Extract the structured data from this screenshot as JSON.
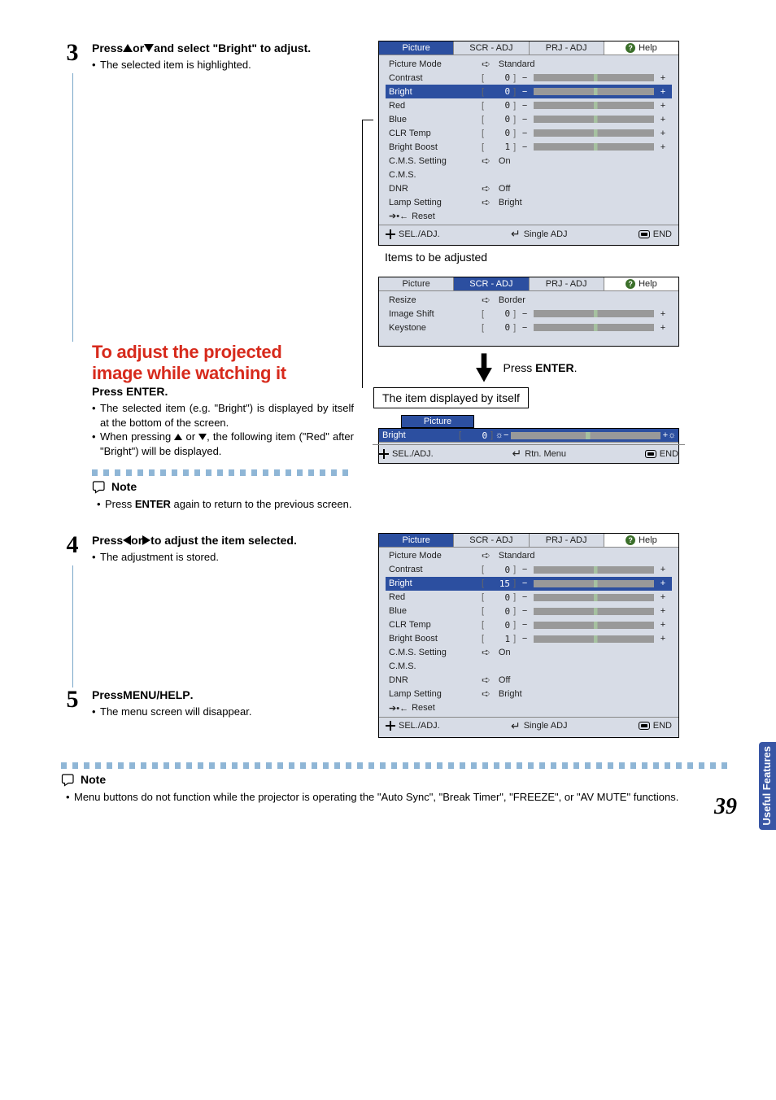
{
  "page_number": "39",
  "thumb_tab": "Useful Features",
  "step3": {
    "num": "3",
    "title_parts": [
      "Press ",
      " or ",
      " and select \"Bright\" to adjust."
    ],
    "bullet": "The selected item is highlighted."
  },
  "adjust_section": {
    "heading1": "To adjust the projected",
    "heading2": "image while watching it",
    "press": "Press ",
    "press_cmd": "ENTER",
    "press_suffix": ".",
    "b1": "The selected item (e.g. \"Bright\") is displayed by itself at the bottom of the screen.",
    "b2a": "When pressing ",
    "b2b": " or ",
    "b2c": ", the following item (\"Red\" after \"Bright\") will be displayed."
  },
  "note1": {
    "label": "Note",
    "text_a": "Press ",
    "text_b": "ENTER",
    "text_c": " again to return to the previous screen."
  },
  "step4": {
    "num": "4",
    "title_parts": [
      "Press ",
      " or ",
      " to adjust the item selected."
    ],
    "bullet": "The adjustment is stored."
  },
  "step5": {
    "num": "5",
    "title": "Press ",
    "cmd": "MENU/HELP",
    "suffix": ".",
    "bullet": "The menu screen will disappear."
  },
  "note2": {
    "label": "Note",
    "text": "Menu buttons do not function while the projector is operating the \"Auto Sync\", \"Break Timer\", \"FREEZE\", or \"AV MUTE\" functions."
  },
  "callout_items": "Items to be adjusted",
  "press_enter_callout": {
    "pre": "Press ",
    "cmd": "ENTER",
    "suf": "."
  },
  "item_displayed": "The item displayed by itself",
  "osd_common": {
    "tabs": [
      "Picture",
      "SCR - ADJ",
      "PRJ - ADJ"
    ],
    "help": "Help",
    "foot_sel": "SEL./ADJ.",
    "foot_single": "Single ADJ",
    "foot_rtn": "Rtn. Menu",
    "foot_end": "END"
  },
  "osd1": {
    "picture_mode": {
      "label": "Picture Mode",
      "value": "Standard"
    },
    "rows": [
      {
        "label": "Contrast",
        "val": "0"
      },
      {
        "label": "Bright",
        "val": "0",
        "hl": true
      },
      {
        "label": "Red",
        "val": "0"
      },
      {
        "label": "Blue",
        "val": "0"
      },
      {
        "label": "CLR Temp",
        "val": "0"
      },
      {
        "label": "Bright Boost",
        "val": "1"
      }
    ],
    "opts": [
      {
        "label": "C.M.S. Setting",
        "value": "On"
      },
      {
        "label": "C.M.S.",
        "value": ""
      },
      {
        "label": "DNR",
        "value": "Off"
      },
      {
        "label": "Lamp Setting",
        "value": "Bright"
      }
    ],
    "reset": "Reset"
  },
  "osd2": {
    "resize": {
      "label": "Resize",
      "value": "Border"
    },
    "rows": [
      {
        "label": "Image Shift",
        "val": "0"
      },
      {
        "label": "Keystone",
        "val": "0"
      }
    ]
  },
  "osd3": {
    "tab": "Picture",
    "row": {
      "label": "Bright",
      "val": "0"
    }
  },
  "osd4_bright_val": "15",
  "chart_data": {
    "type": "table",
    "title": "Picture menu adjustment values shown in OSD screenshots",
    "rows": [
      {
        "screenshot": "top",
        "item": "Contrast",
        "value": 0
      },
      {
        "screenshot": "top",
        "item": "Bright",
        "value": 0
      },
      {
        "screenshot": "top",
        "item": "Red",
        "value": 0
      },
      {
        "screenshot": "top",
        "item": "Blue",
        "value": 0
      },
      {
        "screenshot": "top",
        "item": "CLR Temp",
        "value": 0
      },
      {
        "screenshot": "top",
        "item": "Bright Boost",
        "value": 1
      },
      {
        "screenshot": "bottom",
        "item": "Bright",
        "value": 15
      }
    ]
  }
}
